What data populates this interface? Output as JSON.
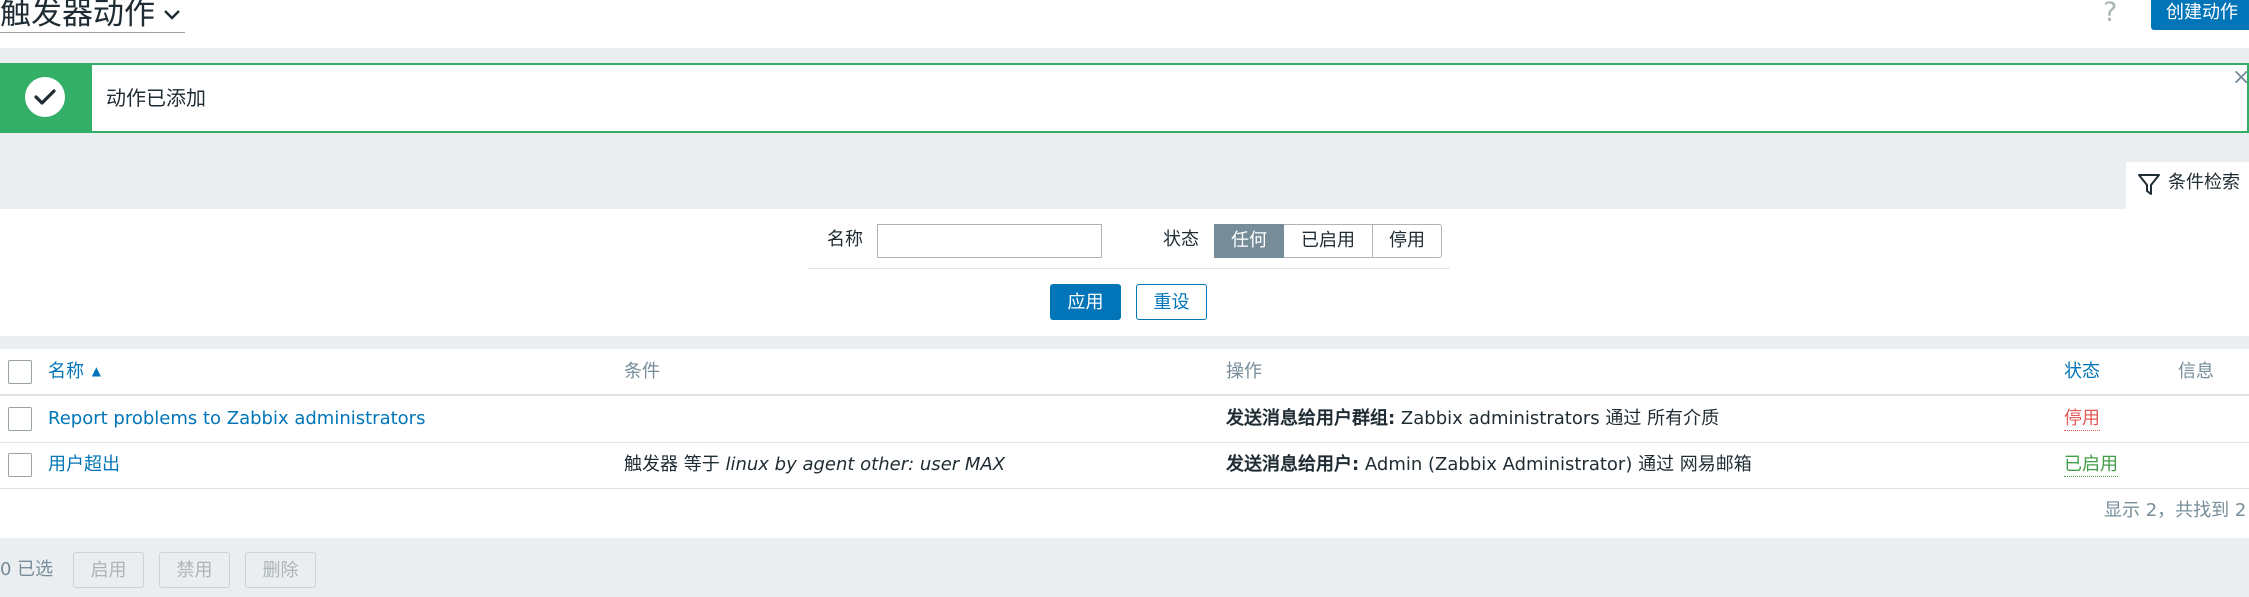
{
  "header": {
    "title": "触发器动作",
    "help_label": "?",
    "create_button": "创建动作"
  },
  "message": {
    "text": "动作已添加",
    "close": "×"
  },
  "filter": {
    "tab_label": "条件检索",
    "name_label": "名称",
    "name_value": "",
    "status_label": "状态",
    "status_options": [
      "任何",
      "已启用",
      "停用"
    ],
    "status_selected": "任何",
    "apply": "应用",
    "reset": "重设"
  },
  "table": {
    "columns": [
      "名称",
      "条件",
      "操作",
      "状态",
      "信息"
    ],
    "sort_indicator": "▲",
    "rows": [
      {
        "name": "Report problems to Zabbix administrators",
        "condition": {
          "prefix": "",
          "value": ""
        },
        "operation": {
          "type": "发送消息给用户群组:",
          "detail": " Zabbix administrators 通过 所有介质"
        },
        "status": "停用"
      },
      {
        "name": "用户超出",
        "condition": {
          "prefix": "触发器 等于 ",
          "value": "linux by agent other: user MAX"
        },
        "operation": {
          "type": "发送消息给用户:",
          "detail": " Admin (Zabbix Administrator) 通过 网易邮箱"
        },
        "status": "已启用"
      }
    ],
    "pager": "显示 2，共找到 2"
  },
  "footer": {
    "selected_count": "0 已选",
    "actions": [
      "启用",
      "禁用",
      "删除"
    ]
  },
  "colors": {
    "accent": "#0275b8",
    "success": "#34af67",
    "disabled_status": "#e45959",
    "enabled_status": "#429e47"
  }
}
